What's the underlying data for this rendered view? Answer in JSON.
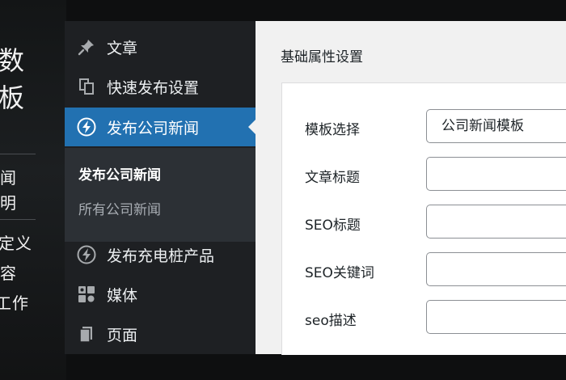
{
  "background": {
    "fragments": [
      "数",
      "板",
      "闻",
      "明",
      "定义",
      "容",
      "工作"
    ]
  },
  "sidebar": {
    "items": [
      {
        "label": "文章",
        "icon": "pushpin-icon"
      },
      {
        "label": "快速发布设置",
        "icon": "copy-icon"
      },
      {
        "label": "发布公司新闻",
        "icon": "bolt-icon",
        "active": true
      },
      {
        "label": "发布充电桩产品",
        "icon": "bolt-icon"
      },
      {
        "label": "媒体",
        "icon": "media-icon"
      },
      {
        "label": "页面",
        "icon": "page-icon"
      }
    ],
    "submenu": [
      {
        "label": "发布公司新闻",
        "current": true
      },
      {
        "label": "所有公司新闻"
      }
    ]
  },
  "content": {
    "section_title": "基础属性设置",
    "fields": [
      {
        "label": "模板选择",
        "value": "公司新闻模板"
      },
      {
        "label": "文章标题",
        "value": ""
      },
      {
        "label": "SEO标题",
        "value": ""
      },
      {
        "label": "SEO关键词",
        "value": ""
      },
      {
        "label": "seo描述",
        "value": ""
      }
    ]
  },
  "colors": {
    "accent": "#2271b1",
    "sidebar_bg": "#1e2023",
    "submenu_bg": "#2c3035",
    "content_bg": "#f1f1f1"
  }
}
